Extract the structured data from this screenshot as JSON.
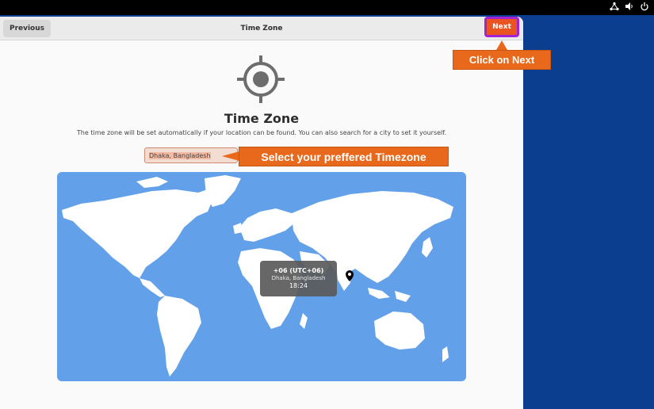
{
  "system_tray": {
    "network_icon": "network-icon",
    "volume_icon": "volume-icon",
    "power_icon": "power-icon"
  },
  "header": {
    "previous_label": "Previous",
    "title": "Time Zone",
    "next_label": "Next"
  },
  "main": {
    "icon": "location-crosshair-icon",
    "title": "Time Zone",
    "subtitle": "The time zone will be set automatically if your location can be found. You can also search for a city to set it yourself.",
    "search_value": "Dhaka, Bangladesh"
  },
  "map": {
    "tooltip_offset": "+06 (UTC+06)",
    "tooltip_city": "Dhaka, Bangladesh",
    "tooltip_time": "18:24",
    "pin_icon": "map-pin-icon"
  },
  "annotations": {
    "next_callout": "Click on Next",
    "timezone_callout": "Select your preffered Timezone"
  },
  "colors": {
    "accent": "#e95420",
    "highlight_border": "#a321d6",
    "map_water": "#62a0ea",
    "desktop": "#0b3e8f",
    "callout": "#e9691c"
  }
}
